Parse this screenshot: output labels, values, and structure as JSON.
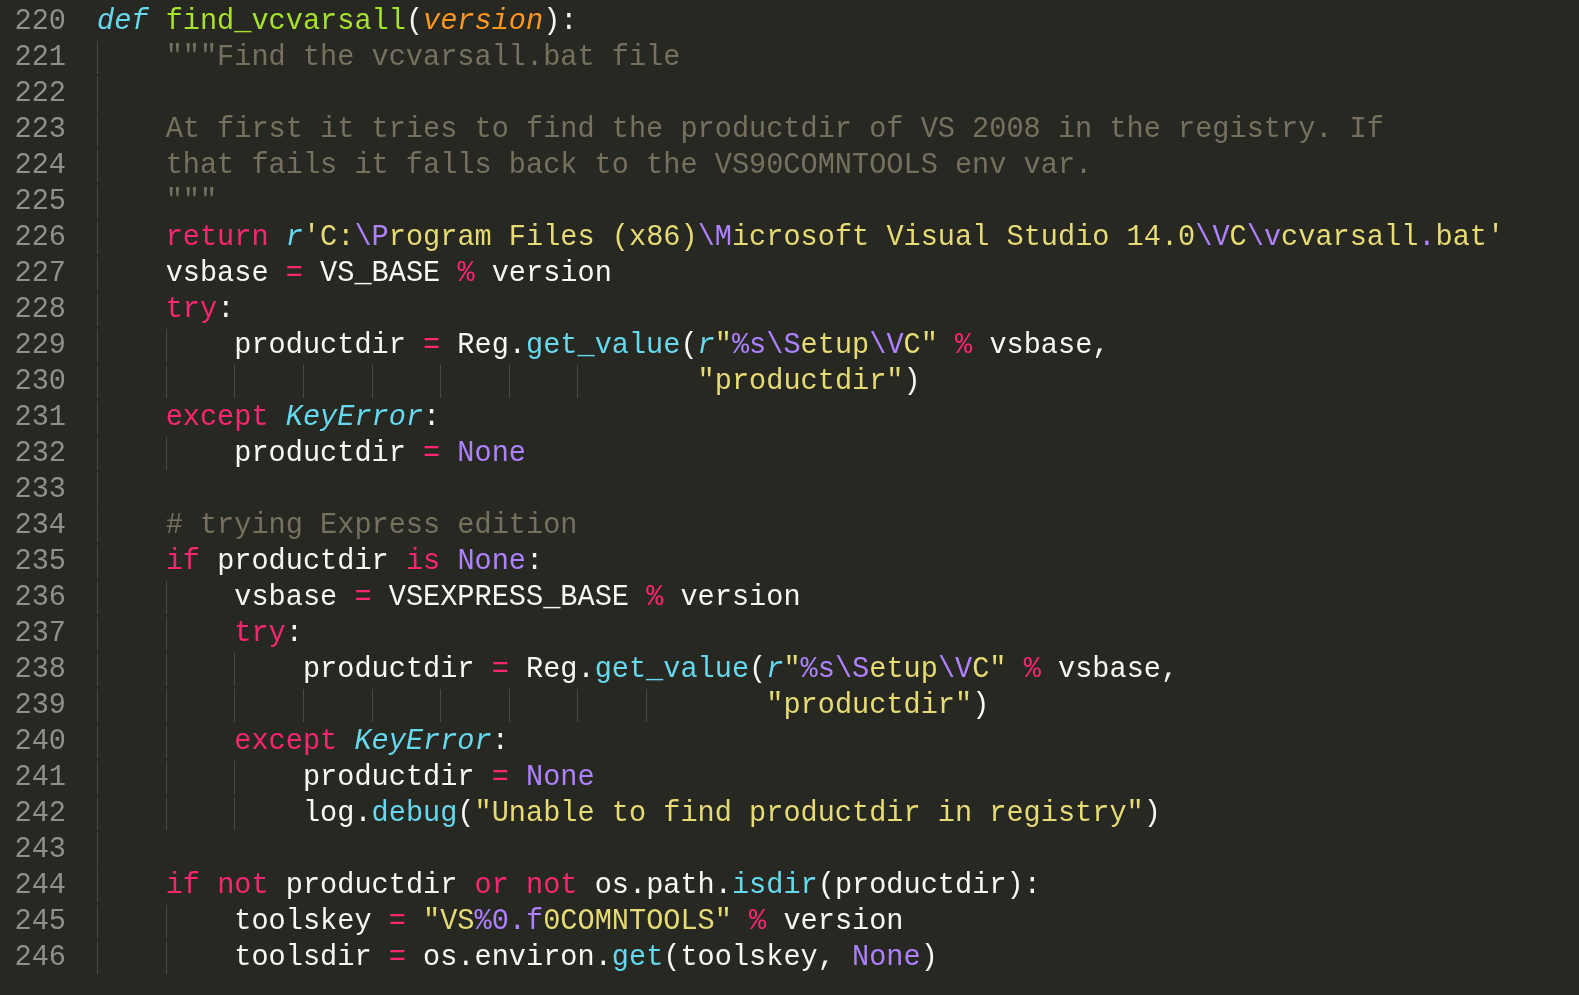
{
  "editor": {
    "lines": [
      {
        "number": "220",
        "tokens": [
          {
            "text": "def",
            "kind": "storage"
          },
          {
            "text": " find_vcvarsall",
            "kind": "function"
          },
          {
            "text": "(",
            "kind": "plain"
          },
          {
            "text": "version",
            "kind": "param"
          },
          {
            "text": "):",
            "kind": "plain"
          }
        ]
      },
      {
        "number": "221",
        "tokens": [
          {
            "text": "    \"\"\"Find the vcvarsall.bat file",
            "kind": "comment"
          }
        ]
      },
      {
        "number": "222"
      },
      {
        "number": "223",
        "tokens": [
          {
            "text": "    At first it tries to find the productdir of VS 2008 in the registry. If",
            "kind": "comment"
          }
        ]
      },
      {
        "number": "224",
        "tokens": [
          {
            "text": "    that fails it falls back to the VS90COMNTOOLS env var.",
            "kind": "comment"
          }
        ]
      },
      {
        "number": "225",
        "tokens": [
          {
            "text": "    \"\"\"",
            "kind": "comment"
          }
        ]
      },
      {
        "number": "226",
        "tokens": [
          {
            "text": "    return",
            "kind": "keyword"
          },
          {
            "text": " r",
            "kind": "storage"
          },
          {
            "text": "'C:",
            "kind": "string"
          },
          {
            "text": "\\P",
            "kind": "escape"
          },
          {
            "text": "rogram Files (x86)",
            "kind": "string"
          },
          {
            "text": "\\M",
            "kind": "escape"
          },
          {
            "text": "icrosoft Visual Studio 14.0",
            "kind": "string"
          },
          {
            "text": "\\V",
            "kind": "escape"
          },
          {
            "text": "C",
            "kind": "string"
          },
          {
            "text": "\\v",
            "kind": "escape"
          },
          {
            "text": "cvarsall",
            "kind": "string"
          },
          {
            "text": ".",
            "kind": "escape"
          },
          {
            "text": "bat'",
            "kind": "string"
          }
        ]
      },
      {
        "number": "227",
        "tokens": [
          {
            "text": "    vsbase ",
            "kind": "plain"
          },
          {
            "text": "=",
            "kind": "operator"
          },
          {
            "text": " VS_BASE ",
            "kind": "plain"
          },
          {
            "text": "%",
            "kind": "operator"
          },
          {
            "text": " version",
            "kind": "plain"
          }
        ]
      },
      {
        "number": "228",
        "tokens": [
          {
            "text": "    try",
            "kind": "keyword"
          },
          {
            "text": ":",
            "kind": "plain"
          }
        ]
      },
      {
        "number": "229",
        "tokens": [
          {
            "text": "        productdir ",
            "kind": "plain"
          },
          {
            "text": "=",
            "kind": "operator"
          },
          {
            "text": " Reg.",
            "kind": "plain"
          },
          {
            "text": "get_value",
            "kind": "support"
          },
          {
            "text": "(",
            "kind": "plain"
          },
          {
            "text": "r",
            "kind": "storage"
          },
          {
            "text": "\"",
            "kind": "string"
          },
          {
            "text": "%s\\S",
            "kind": "escape"
          },
          {
            "text": "etup",
            "kind": "string"
          },
          {
            "text": "\\V",
            "kind": "escape"
          },
          {
            "text": "C\"",
            "kind": "string"
          },
          {
            "text": " %",
            "kind": "operator"
          },
          {
            "text": " vsbase,",
            "kind": "plain"
          }
        ]
      },
      {
        "number": "230",
        "tokens": [
          {
            "text": "                                   \"productdir\"",
            "kind": "string"
          },
          {
            "text": ")",
            "kind": "plain"
          }
        ]
      },
      {
        "number": "231",
        "tokens": [
          {
            "text": "    except",
            "kind": "keyword"
          },
          {
            "text": " KeyError",
            "kind": "type"
          },
          {
            "text": ":",
            "kind": "plain"
          }
        ]
      },
      {
        "number": "232",
        "tokens": [
          {
            "text": "        productdir ",
            "kind": "plain"
          },
          {
            "text": "=",
            "kind": "operator"
          },
          {
            "text": " None",
            "kind": "constant"
          }
        ]
      },
      {
        "number": "233"
      },
      {
        "number": "234",
        "tokens": [
          {
            "text": "    # trying Express edition",
            "kind": "comment"
          }
        ]
      },
      {
        "number": "235",
        "tokens": [
          {
            "text": "    if",
            "kind": "keyword"
          },
          {
            "text": " productdir ",
            "kind": "plain"
          },
          {
            "text": "is",
            "kind": "keyword"
          },
          {
            "text": " None",
            "kind": "constant"
          },
          {
            "text": ":",
            "kind": "plain"
          }
        ]
      },
      {
        "number": "236",
        "tokens": [
          {
            "text": "        vsbase ",
            "kind": "plain"
          },
          {
            "text": "=",
            "kind": "operator"
          },
          {
            "text": " VSEXPRESS_BASE ",
            "kind": "plain"
          },
          {
            "text": "%",
            "kind": "operator"
          },
          {
            "text": " version",
            "kind": "plain"
          }
        ]
      },
      {
        "number": "237",
        "tokens": [
          {
            "text": "        try",
            "kind": "keyword"
          },
          {
            "text": ":",
            "kind": "plain"
          }
        ]
      },
      {
        "number": "238",
        "tokens": [
          {
            "text": "            productdir ",
            "kind": "plain"
          },
          {
            "text": "=",
            "kind": "operator"
          },
          {
            "text": " Reg.",
            "kind": "plain"
          },
          {
            "text": "get_value",
            "kind": "support"
          },
          {
            "text": "(",
            "kind": "plain"
          },
          {
            "text": "r",
            "kind": "storage"
          },
          {
            "text": "\"",
            "kind": "string"
          },
          {
            "text": "%s\\S",
            "kind": "escape"
          },
          {
            "text": "etup",
            "kind": "string"
          },
          {
            "text": "\\V",
            "kind": "escape"
          },
          {
            "text": "C\"",
            "kind": "string"
          },
          {
            "text": " %",
            "kind": "operator"
          },
          {
            "text": " vsbase,",
            "kind": "plain"
          }
        ]
      },
      {
        "number": "239",
        "tokens": [
          {
            "text": "                                       \"productdir\"",
            "kind": "string"
          },
          {
            "text": ")",
            "kind": "plain"
          }
        ]
      },
      {
        "number": "240",
        "tokens": [
          {
            "text": "        except",
            "kind": "keyword"
          },
          {
            "text": " KeyError",
            "kind": "type"
          },
          {
            "text": ":",
            "kind": "plain"
          }
        ]
      },
      {
        "number": "241",
        "tokens": [
          {
            "text": "            productdir ",
            "kind": "plain"
          },
          {
            "text": "=",
            "kind": "operator"
          },
          {
            "text": " None",
            "kind": "constant"
          }
        ]
      },
      {
        "number": "242",
        "tokens": [
          {
            "text": "            log.",
            "kind": "plain"
          },
          {
            "text": "debug",
            "kind": "support"
          },
          {
            "text": "(",
            "kind": "plain"
          },
          {
            "text": "\"Unable to find productdir in registry\"",
            "kind": "string"
          },
          {
            "text": ")",
            "kind": "plain"
          }
        ]
      },
      {
        "number": "243"
      },
      {
        "number": "244",
        "tokens": [
          {
            "text": "    if",
            "kind": "keyword"
          },
          {
            "text": " not",
            "kind": "keyword"
          },
          {
            "text": " productdir ",
            "kind": "plain"
          },
          {
            "text": "or",
            "kind": "keyword"
          },
          {
            "text": " not",
            "kind": "keyword"
          },
          {
            "text": " os.path.",
            "kind": "plain"
          },
          {
            "text": "isdir",
            "kind": "support"
          },
          {
            "text": "(productdir):",
            "kind": "plain"
          }
        ]
      },
      {
        "number": "245",
        "tokens": [
          {
            "text": "        toolskey ",
            "kind": "plain"
          },
          {
            "text": "=",
            "kind": "operator"
          },
          {
            "text": " \"VS",
            "kind": "string"
          },
          {
            "text": "%0.f",
            "kind": "escape"
          },
          {
            "text": "0COMNTOOLS\"",
            "kind": "string"
          },
          {
            "text": " %",
            "kind": "operator"
          },
          {
            "text": " version",
            "kind": "plain"
          }
        ]
      },
      {
        "number": "246",
        "tokens": [
          {
            "text": "        toolsdir ",
            "kind": "plain"
          },
          {
            "text": "=",
            "kind": "operator"
          },
          {
            "text": " os.environ.",
            "kind": "plain"
          },
          {
            "text": "get",
            "kind": "support"
          },
          {
            "text": "(toolskey, ",
            "kind": "plain"
          },
          {
            "text": "None",
            "kind": "constant"
          },
          {
            "text": ")",
            "kind": "plain"
          }
        ]
      }
    ]
  }
}
